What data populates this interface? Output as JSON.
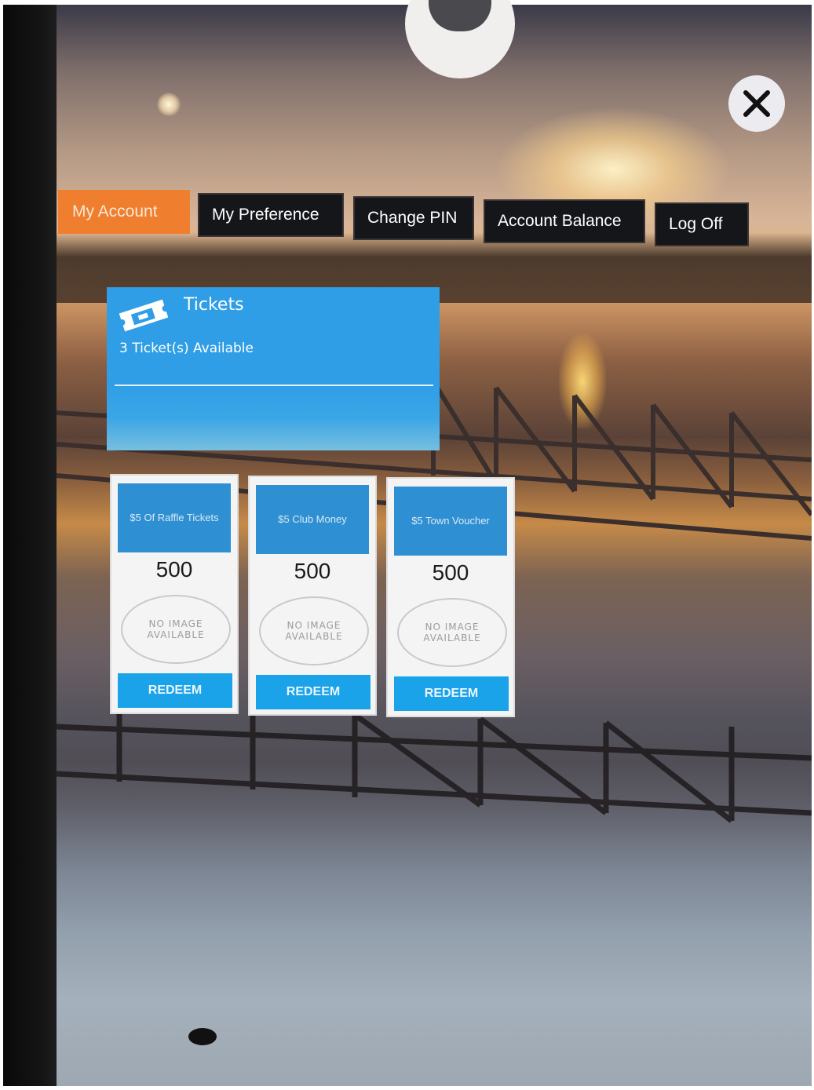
{
  "close_icon": "close-icon",
  "avatar_icon": "avatar-silhouette-icon",
  "ticket_icon": "ticket-icon",
  "colors": {
    "active_tab": "#ef7f2e",
    "tab_bg": "#15161a",
    "card_blue": "#2f9ee6",
    "redeem_blue": "#1aa3e8"
  },
  "tabs": [
    {
      "label": "My Account",
      "active": true
    },
    {
      "label": "My Preference",
      "active": false
    },
    {
      "label": "Change PIN",
      "active": false
    },
    {
      "label": "Account Balance",
      "active": false
    },
    {
      "label": "Log Off",
      "active": false
    }
  ],
  "tickets": {
    "title": "Tickets",
    "available": "3 Ticket(s) Available"
  },
  "rewards": [
    {
      "name": "$5 Of Raffle Tickets",
      "points": "500",
      "image_text": "NO IMAGE AVAILABLE",
      "button": "REDEEM"
    },
    {
      "name": "$5 Club Money",
      "points": "500",
      "image_text": "NO IMAGE AVAILABLE",
      "button": "REDEEM"
    },
    {
      "name": "$5 Town Voucher",
      "points": "500",
      "image_text": "NO IMAGE AVAILABLE",
      "button": "REDEEM"
    }
  ]
}
